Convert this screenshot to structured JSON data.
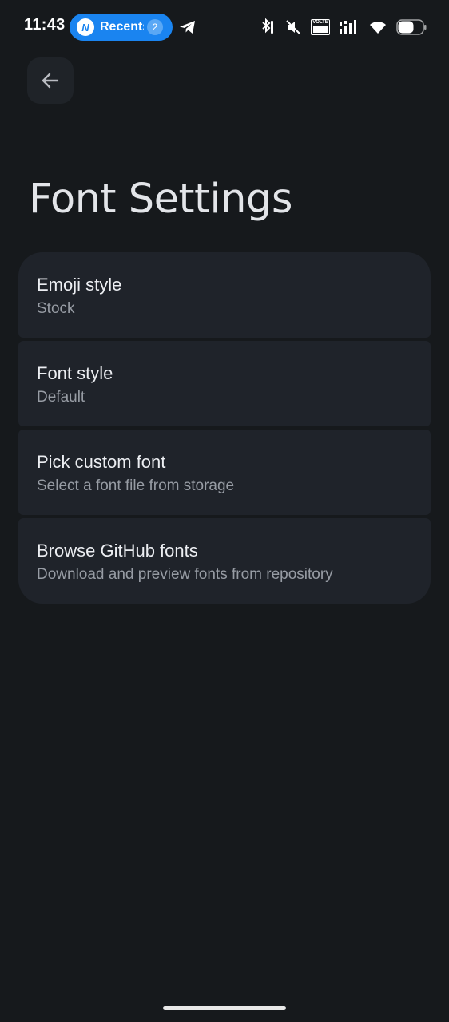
{
  "status_bar": {
    "time": "11:43",
    "recents": {
      "label": "Recents",
      "logo_letter": "N",
      "count": "2"
    },
    "icons": [
      "telegram-icon",
      "bluetooth-icon",
      "mute-icon",
      "volte-icon",
      "signal-icon",
      "wifi-icon",
      "battery-icon"
    ],
    "volte_label": "VOLTE"
  },
  "header": {
    "back_icon": "arrow-left-icon",
    "title": "Font Settings"
  },
  "settings": {
    "items": [
      {
        "title": "Emoji style",
        "subtitle": "Stock"
      },
      {
        "title": "Font style",
        "subtitle": "Default"
      },
      {
        "title": "Pick custom font",
        "subtitle": "Select a font file from storage"
      },
      {
        "title": "Browse GitHub fonts",
        "subtitle": "Download and preview fonts from repository"
      }
    ]
  },
  "colors": {
    "background": "#16191c",
    "card": "#1f232a",
    "accent_pill": "#1a84f0"
  }
}
